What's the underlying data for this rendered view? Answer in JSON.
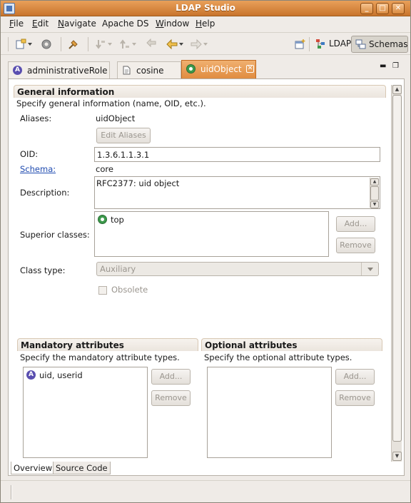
{
  "window": {
    "title": "LDAP Studio"
  },
  "menu": {
    "items": [
      {
        "underline": "F",
        "rest": "ile"
      },
      {
        "underline": "E",
        "rest": "dit"
      },
      {
        "underline": "N",
        "rest": "avigate"
      },
      {
        "underline": "",
        "rest": "Apache DS"
      },
      {
        "underline": "W",
        "rest": "indow"
      },
      {
        "underline": "H",
        "rest": "elp"
      }
    ]
  },
  "toolbar": {
    "perspectives": [
      {
        "label": "LDAP",
        "active": false
      },
      {
        "label": "Schemas",
        "active": true
      }
    ]
  },
  "tabs": [
    {
      "label": "administrativeRole",
      "icon": "attribute-type-icon",
      "active": false
    },
    {
      "label": "cosine",
      "icon": "schema-file-icon",
      "active": false
    },
    {
      "label": "uidObject",
      "icon": "object-class-icon",
      "active": true
    }
  ],
  "general": {
    "title": "General information",
    "description": "Specify general information (name, OID, etc.).",
    "aliases_label": "Aliases:",
    "aliases_value": "uidObject",
    "edit_aliases_button": "Edit Aliases",
    "oid_label": "OID:",
    "oid_value": "1.3.6.1.1.3.1",
    "schema_label": "Schema:",
    "schema_value": "core",
    "description_label": "Description:",
    "description_value": "RFC2377: uid object",
    "superior_label": "Superior classes:",
    "superior_items": [
      "top"
    ],
    "add_button": "Add...",
    "remove_button": "Remove",
    "class_type_label": "Class type:",
    "class_type_value": "Auxiliary",
    "obsolete_label": "Obsolete"
  },
  "mandatory": {
    "title": "Mandatory attributes",
    "description": "Specify the mandatory attribute types.",
    "items": [
      "uid, userid"
    ],
    "add_button": "Add...",
    "remove_button": "Remove"
  },
  "optional": {
    "title": "Optional attributes",
    "description": "Specify the optional attribute types.",
    "items": [],
    "add_button": "Add...",
    "remove_button": "Remove"
  },
  "editor_tabs": [
    {
      "label": "Overview",
      "active": true
    },
    {
      "label": "Source Code",
      "active": false
    }
  ]
}
